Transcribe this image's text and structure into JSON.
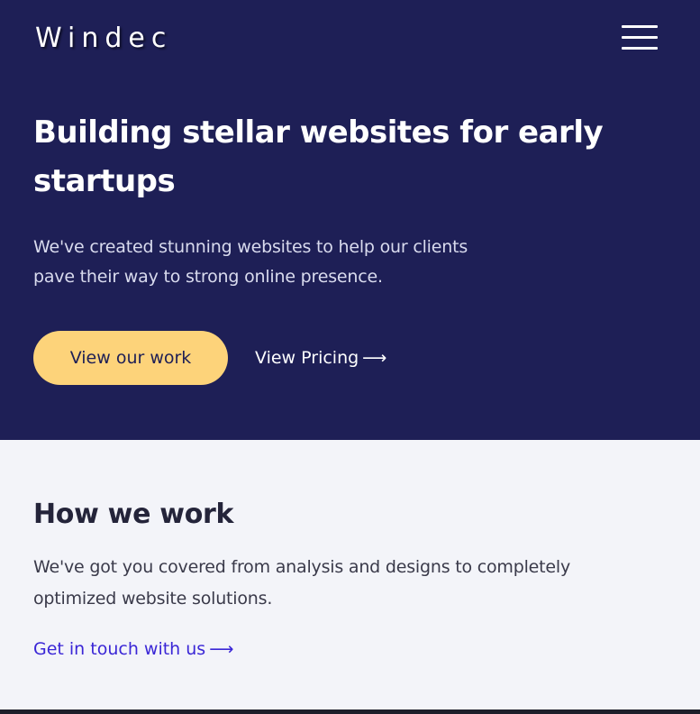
{
  "header": {
    "logo": "Windec",
    "menu_icon": "hamburger-menu-icon"
  },
  "hero": {
    "title": "Building stellar websites for early startups",
    "subtitle": "We've created stunning websites to help our clients pave their way to strong online presence.",
    "primary_button": "View our work",
    "secondary_link": "View Pricing",
    "arrow": "⟶"
  },
  "how": {
    "title": "How we work",
    "subtitle": "We've got you covered from analysis and designs to completely optimized website solutions.",
    "link": "Get in touch with us",
    "arrow": "⟶"
  },
  "colors": {
    "hero_bg": "#1e1f56",
    "accent_button": "#fdd37a",
    "link_blue": "#3a26d6",
    "section_bg": "#f3f4f9"
  }
}
